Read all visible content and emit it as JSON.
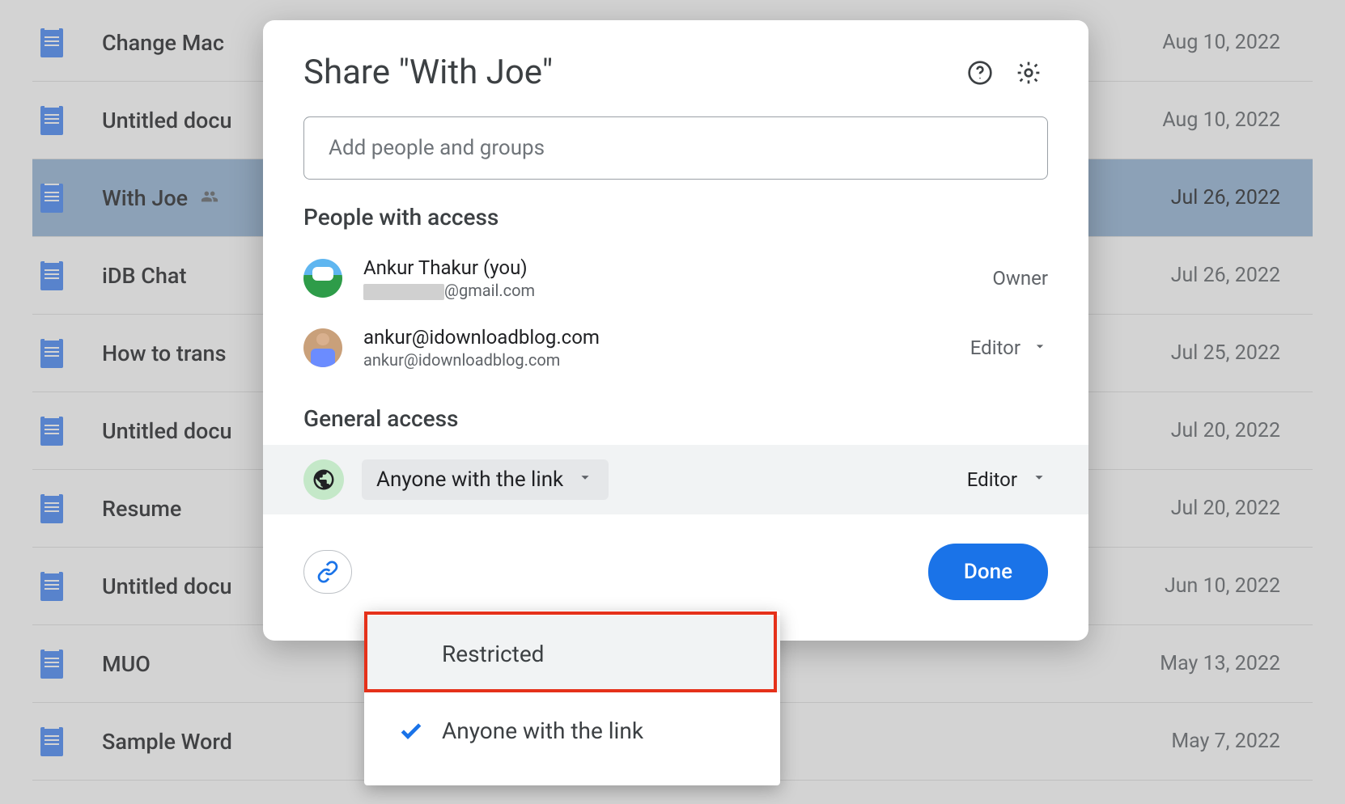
{
  "files": [
    {
      "name": "Change Mac",
      "date": "Aug 10, 2022",
      "shared": false,
      "selected": false
    },
    {
      "name": "Untitled docu",
      "date": "Aug 10, 2022",
      "shared": false,
      "selected": false
    },
    {
      "name": "With Joe",
      "date": "Jul 26, 2022",
      "shared": true,
      "selected": true
    },
    {
      "name": "iDB Chat",
      "date": "Jul 26, 2022",
      "shared": false,
      "selected": false
    },
    {
      "name": "How to trans",
      "date": "Jul 25, 2022",
      "shared": false,
      "selected": false
    },
    {
      "name": "Untitled docu",
      "date": "Jul 20, 2022",
      "shared": false,
      "selected": false
    },
    {
      "name": "Resume",
      "date": "Jul 20, 2022",
      "shared": false,
      "selected": false
    },
    {
      "name": "Untitled docu",
      "date": "Jun 10, 2022",
      "shared": false,
      "selected": false
    },
    {
      "name": "MUO",
      "date": "May 13, 2022",
      "shared": false,
      "selected": false
    },
    {
      "name": "Sample Word",
      "date": "May 7, 2022",
      "shared": false,
      "selected": false
    }
  ],
  "dialog": {
    "title": "Share \"With Joe\"",
    "add_placeholder": "Add people and groups",
    "people_header": "People with access",
    "owner_label": "Owner",
    "people": [
      {
        "name": "Ankur Thakur (you)",
        "email_suffix": "@gmail.com",
        "role": "Owner"
      },
      {
        "name": "ankur@idownloadblog.com",
        "email": "ankur@idownloadblog.com",
        "role": "Editor"
      }
    ],
    "general_header": "General access",
    "general_selected": "Anyone with the link",
    "general_role": "Editor",
    "done": "Done",
    "menu": {
      "restricted": "Restricted",
      "anyone": "Anyone with the link",
      "selected": "anyone"
    }
  }
}
